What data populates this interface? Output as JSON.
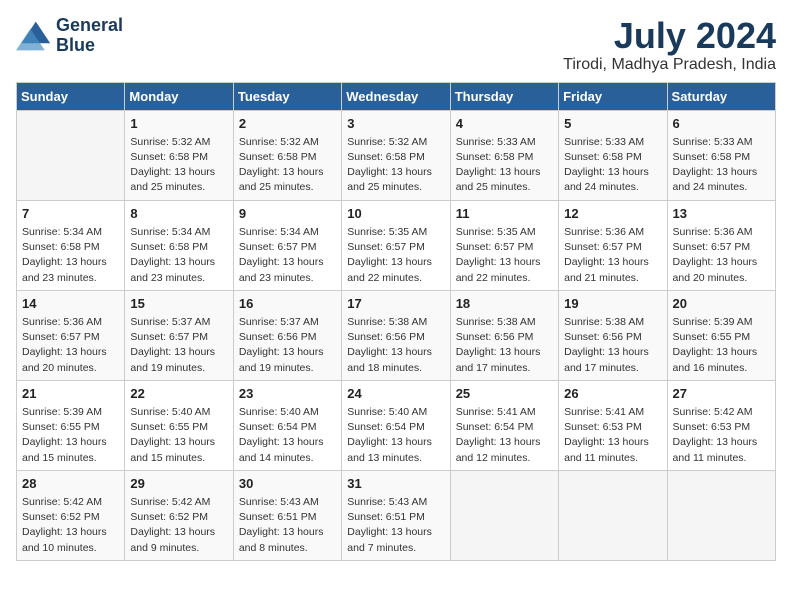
{
  "logo": {
    "line1": "General",
    "line2": "Blue"
  },
  "title": "July 2024",
  "subtitle": "Tirodi, Madhya Pradesh, India",
  "days_of_week": [
    "Sunday",
    "Monday",
    "Tuesday",
    "Wednesday",
    "Thursday",
    "Friday",
    "Saturday"
  ],
  "weeks": [
    [
      {
        "day": "",
        "info": ""
      },
      {
        "day": "1",
        "info": "Sunrise: 5:32 AM\nSunset: 6:58 PM\nDaylight: 13 hours\nand 25 minutes."
      },
      {
        "day": "2",
        "info": "Sunrise: 5:32 AM\nSunset: 6:58 PM\nDaylight: 13 hours\nand 25 minutes."
      },
      {
        "day": "3",
        "info": "Sunrise: 5:32 AM\nSunset: 6:58 PM\nDaylight: 13 hours\nand 25 minutes."
      },
      {
        "day": "4",
        "info": "Sunrise: 5:33 AM\nSunset: 6:58 PM\nDaylight: 13 hours\nand 25 minutes."
      },
      {
        "day": "5",
        "info": "Sunrise: 5:33 AM\nSunset: 6:58 PM\nDaylight: 13 hours\nand 24 minutes."
      },
      {
        "day": "6",
        "info": "Sunrise: 5:33 AM\nSunset: 6:58 PM\nDaylight: 13 hours\nand 24 minutes."
      }
    ],
    [
      {
        "day": "7",
        "info": "Sunrise: 5:34 AM\nSunset: 6:58 PM\nDaylight: 13 hours\nand 23 minutes."
      },
      {
        "day": "8",
        "info": "Sunrise: 5:34 AM\nSunset: 6:58 PM\nDaylight: 13 hours\nand 23 minutes."
      },
      {
        "day": "9",
        "info": "Sunrise: 5:34 AM\nSunset: 6:57 PM\nDaylight: 13 hours\nand 23 minutes."
      },
      {
        "day": "10",
        "info": "Sunrise: 5:35 AM\nSunset: 6:57 PM\nDaylight: 13 hours\nand 22 minutes."
      },
      {
        "day": "11",
        "info": "Sunrise: 5:35 AM\nSunset: 6:57 PM\nDaylight: 13 hours\nand 22 minutes."
      },
      {
        "day": "12",
        "info": "Sunrise: 5:36 AM\nSunset: 6:57 PM\nDaylight: 13 hours\nand 21 minutes."
      },
      {
        "day": "13",
        "info": "Sunrise: 5:36 AM\nSunset: 6:57 PM\nDaylight: 13 hours\nand 20 minutes."
      }
    ],
    [
      {
        "day": "14",
        "info": "Sunrise: 5:36 AM\nSunset: 6:57 PM\nDaylight: 13 hours\nand 20 minutes."
      },
      {
        "day": "15",
        "info": "Sunrise: 5:37 AM\nSunset: 6:57 PM\nDaylight: 13 hours\nand 19 minutes."
      },
      {
        "day": "16",
        "info": "Sunrise: 5:37 AM\nSunset: 6:56 PM\nDaylight: 13 hours\nand 19 minutes."
      },
      {
        "day": "17",
        "info": "Sunrise: 5:38 AM\nSunset: 6:56 PM\nDaylight: 13 hours\nand 18 minutes."
      },
      {
        "day": "18",
        "info": "Sunrise: 5:38 AM\nSunset: 6:56 PM\nDaylight: 13 hours\nand 17 minutes."
      },
      {
        "day": "19",
        "info": "Sunrise: 5:38 AM\nSunset: 6:56 PM\nDaylight: 13 hours\nand 17 minutes."
      },
      {
        "day": "20",
        "info": "Sunrise: 5:39 AM\nSunset: 6:55 PM\nDaylight: 13 hours\nand 16 minutes."
      }
    ],
    [
      {
        "day": "21",
        "info": "Sunrise: 5:39 AM\nSunset: 6:55 PM\nDaylight: 13 hours\nand 15 minutes."
      },
      {
        "day": "22",
        "info": "Sunrise: 5:40 AM\nSunset: 6:55 PM\nDaylight: 13 hours\nand 15 minutes."
      },
      {
        "day": "23",
        "info": "Sunrise: 5:40 AM\nSunset: 6:54 PM\nDaylight: 13 hours\nand 14 minutes."
      },
      {
        "day": "24",
        "info": "Sunrise: 5:40 AM\nSunset: 6:54 PM\nDaylight: 13 hours\nand 13 minutes."
      },
      {
        "day": "25",
        "info": "Sunrise: 5:41 AM\nSunset: 6:54 PM\nDaylight: 13 hours\nand 12 minutes."
      },
      {
        "day": "26",
        "info": "Sunrise: 5:41 AM\nSunset: 6:53 PM\nDaylight: 13 hours\nand 11 minutes."
      },
      {
        "day": "27",
        "info": "Sunrise: 5:42 AM\nSunset: 6:53 PM\nDaylight: 13 hours\nand 11 minutes."
      }
    ],
    [
      {
        "day": "28",
        "info": "Sunrise: 5:42 AM\nSunset: 6:52 PM\nDaylight: 13 hours\nand 10 minutes."
      },
      {
        "day": "29",
        "info": "Sunrise: 5:42 AM\nSunset: 6:52 PM\nDaylight: 13 hours\nand 9 minutes."
      },
      {
        "day": "30",
        "info": "Sunrise: 5:43 AM\nSunset: 6:51 PM\nDaylight: 13 hours\nand 8 minutes."
      },
      {
        "day": "31",
        "info": "Sunrise: 5:43 AM\nSunset: 6:51 PM\nDaylight: 13 hours\nand 7 minutes."
      },
      {
        "day": "",
        "info": ""
      },
      {
        "day": "",
        "info": ""
      },
      {
        "day": "",
        "info": ""
      }
    ]
  ]
}
